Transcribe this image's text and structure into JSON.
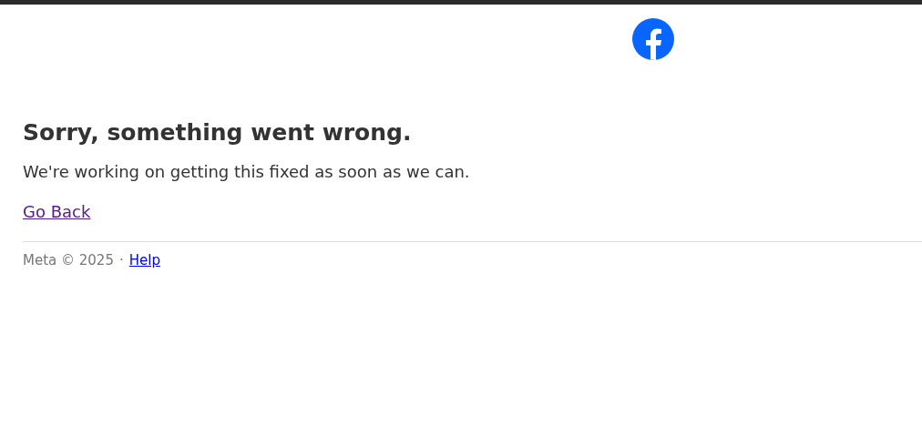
{
  "heading": "Sorry, something went wrong.",
  "message": "We're working on getting this fixed as soon as we can.",
  "back_link": {
    "label": "Go Back",
    "visited": true
  },
  "footer": {
    "copyright": "Meta © 2025",
    "separator": "·",
    "help_link": "Help"
  }
}
